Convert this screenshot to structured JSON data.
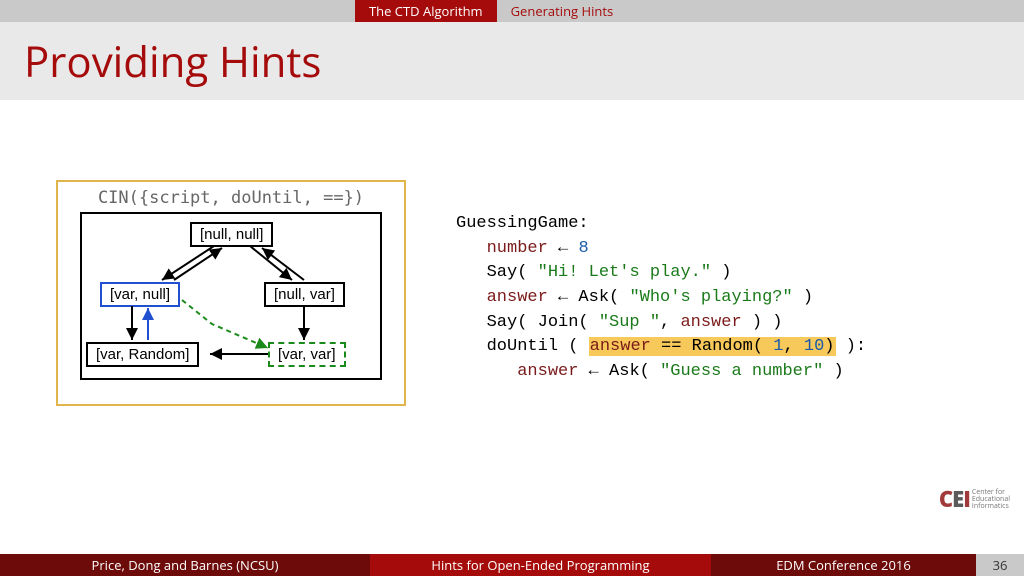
{
  "nav": {
    "tab_active": "The CTD Algorithm",
    "tab_secondary": "Generating Hints"
  },
  "title": "Providing Hints",
  "diagram": {
    "caption": "CIN({script, doUntil, ==})",
    "nodes": {
      "top": "[null, null]",
      "mid_left": "[var, null]",
      "mid_right": "[null, var]",
      "bot_left": "[var, Random]",
      "bot_right": "[var, var]"
    }
  },
  "code": {
    "header": "GuessingGame:",
    "l1_var": "number",
    "l1_assign": " ← ",
    "l1_num": "8",
    "l2_pre": "Say( ",
    "l2_str": "\"Hi! Let's play.\"",
    "l2_post": " )",
    "l3_var": "answer",
    "l3_mid": " ← Ask( ",
    "l3_str": "\"Who's playing?\"",
    "l3_post": " )",
    "l4_pre": "Say( Join( ",
    "l4_str": "\"Sup \"",
    "l4_mid": ", ",
    "l4_var": "answer",
    "l4_post": " ) )",
    "l5_pre": "doUntil ( ",
    "l5_hl_a": "answer",
    "l5_hl_mid": " == Random( ",
    "l5_hl_n1": "1",
    "l5_hl_comma": ", ",
    "l5_hl_n2": "10",
    "l5_hl_close": ")",
    "l5_post": " ):",
    "l6_var": "answer",
    "l6_mid": " ← Ask( ",
    "l6_str": "\"Guess a number\"",
    "l6_post": " )"
  },
  "footer": {
    "authors": "Price, Dong and Barnes (NCSU)",
    "title": "Hints for Open-Ended Programming",
    "conf": "EDM Conference 2016",
    "page": "36"
  },
  "logo": {
    "c": "C",
    "e": "E",
    "i": "I",
    "line1": "Center for",
    "line2": "Educational",
    "line3": "Informatics"
  }
}
